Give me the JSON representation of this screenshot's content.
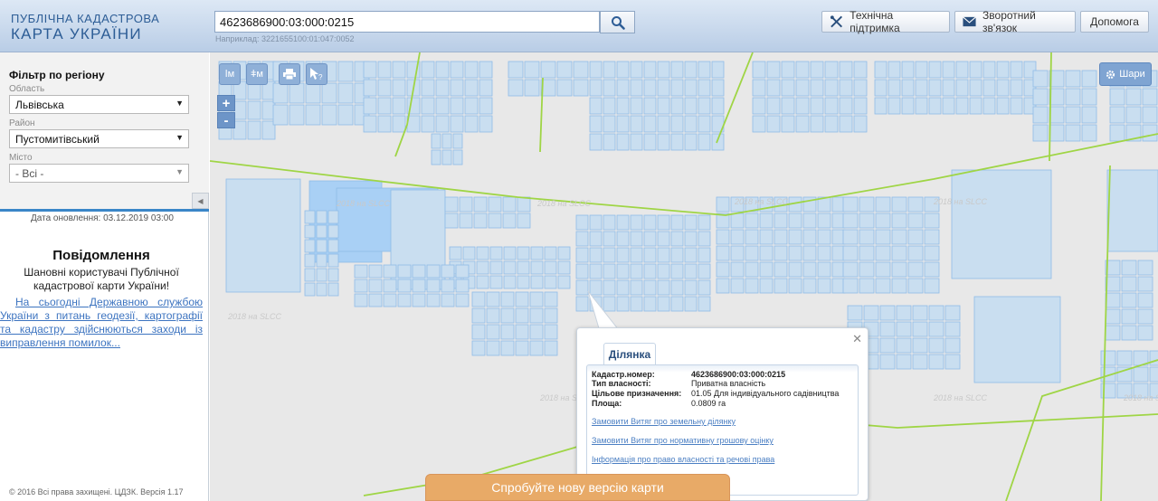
{
  "header": {
    "logo_line1": "ПУБЛІЧНА КАДАСТРОВА",
    "logo_line2": "КАРТА УКРАЇНИ",
    "search_value": "4623686900:03:000:0215",
    "search_example": "Наприклад: 3221655100:01:047:0052",
    "buttons": {
      "support": "Технічна підтримка",
      "feedback": "Зворотний зв'язок",
      "help": "Допомога"
    }
  },
  "sidebar": {
    "filter_title": "Фільтр по регіону",
    "region_label": "Область",
    "region_value": "Львівська",
    "district_label": "Район",
    "district_value": "Пустомитівський",
    "city_label": "Місто",
    "city_value": "- Всі -",
    "update_text": "Дата оновлення: 03.12.2019 03:00",
    "notice_title": "Повідомлення",
    "notice_text": "Шановні користувачі Публічної кадастрової карти України!",
    "notice_link": "На сьогодні Державною службою України з питань геодезії, картографії та кадастру здійснюються заходи із виправлення помилок...",
    "footer": "© 2016 Всі права захищені. ЦДЗК. Версія 1.17"
  },
  "map": {
    "tools": [
      "ǀм",
      "ǂм"
    ],
    "zoom_in": "+",
    "zoom_out": "-",
    "layers_label": "Шари",
    "watermark": "2018 на SLCC"
  },
  "popup": {
    "tab": "Ділянка",
    "fields": [
      {
        "k": "Кадастр.номер:",
        "v": "4623686900:03:000:0215"
      },
      {
        "k": "Тип власності:",
        "v": "Приватна власність"
      },
      {
        "k": "Цільове призначення:",
        "v": "01.05 Для індивідуального садівництва"
      },
      {
        "k": "Площа:",
        "v": "0.0809 га"
      }
    ],
    "links": [
      "Замовити Витяг про земельну ділянку",
      "Замовити Витяг про нормативну грошову оцінку",
      "Інформація про право власності та речові права"
    ]
  },
  "new_version": "Спробуйте нову версію карти"
}
